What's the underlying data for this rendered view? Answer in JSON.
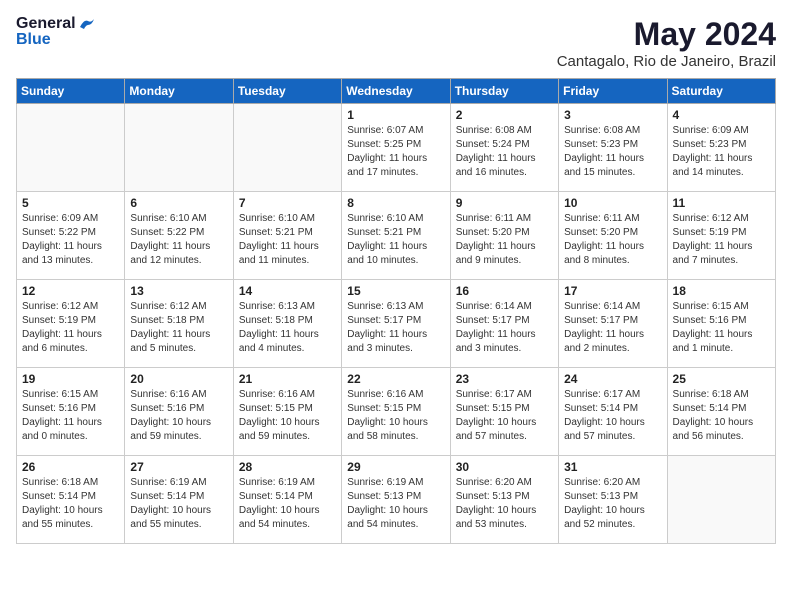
{
  "header": {
    "logo_general": "General",
    "logo_blue": "Blue",
    "month_title": "May 2024",
    "location": "Cantagalo, Rio de Janeiro, Brazil"
  },
  "weekdays": [
    "Sunday",
    "Monday",
    "Tuesday",
    "Wednesday",
    "Thursday",
    "Friday",
    "Saturday"
  ],
  "weeks": [
    [
      {
        "day": "",
        "info": ""
      },
      {
        "day": "",
        "info": ""
      },
      {
        "day": "",
        "info": ""
      },
      {
        "day": "1",
        "info": "Sunrise: 6:07 AM\nSunset: 5:25 PM\nDaylight: 11 hours\nand 17 minutes."
      },
      {
        "day": "2",
        "info": "Sunrise: 6:08 AM\nSunset: 5:24 PM\nDaylight: 11 hours\nand 16 minutes."
      },
      {
        "day": "3",
        "info": "Sunrise: 6:08 AM\nSunset: 5:23 PM\nDaylight: 11 hours\nand 15 minutes."
      },
      {
        "day": "4",
        "info": "Sunrise: 6:09 AM\nSunset: 5:23 PM\nDaylight: 11 hours\nand 14 minutes."
      }
    ],
    [
      {
        "day": "5",
        "info": "Sunrise: 6:09 AM\nSunset: 5:22 PM\nDaylight: 11 hours\nand 13 minutes."
      },
      {
        "day": "6",
        "info": "Sunrise: 6:10 AM\nSunset: 5:22 PM\nDaylight: 11 hours\nand 12 minutes."
      },
      {
        "day": "7",
        "info": "Sunrise: 6:10 AM\nSunset: 5:21 PM\nDaylight: 11 hours\nand 11 minutes."
      },
      {
        "day": "8",
        "info": "Sunrise: 6:10 AM\nSunset: 5:21 PM\nDaylight: 11 hours\nand 10 minutes."
      },
      {
        "day": "9",
        "info": "Sunrise: 6:11 AM\nSunset: 5:20 PM\nDaylight: 11 hours\nand 9 minutes."
      },
      {
        "day": "10",
        "info": "Sunrise: 6:11 AM\nSunset: 5:20 PM\nDaylight: 11 hours\nand 8 minutes."
      },
      {
        "day": "11",
        "info": "Sunrise: 6:12 AM\nSunset: 5:19 PM\nDaylight: 11 hours\nand 7 minutes."
      }
    ],
    [
      {
        "day": "12",
        "info": "Sunrise: 6:12 AM\nSunset: 5:19 PM\nDaylight: 11 hours\nand 6 minutes."
      },
      {
        "day": "13",
        "info": "Sunrise: 6:12 AM\nSunset: 5:18 PM\nDaylight: 11 hours\nand 5 minutes."
      },
      {
        "day": "14",
        "info": "Sunrise: 6:13 AM\nSunset: 5:18 PM\nDaylight: 11 hours\nand 4 minutes."
      },
      {
        "day": "15",
        "info": "Sunrise: 6:13 AM\nSunset: 5:17 PM\nDaylight: 11 hours\nand 3 minutes."
      },
      {
        "day": "16",
        "info": "Sunrise: 6:14 AM\nSunset: 5:17 PM\nDaylight: 11 hours\nand 3 minutes."
      },
      {
        "day": "17",
        "info": "Sunrise: 6:14 AM\nSunset: 5:17 PM\nDaylight: 11 hours\nand 2 minutes."
      },
      {
        "day": "18",
        "info": "Sunrise: 6:15 AM\nSunset: 5:16 PM\nDaylight: 11 hours\nand 1 minute."
      }
    ],
    [
      {
        "day": "19",
        "info": "Sunrise: 6:15 AM\nSunset: 5:16 PM\nDaylight: 11 hours\nand 0 minutes."
      },
      {
        "day": "20",
        "info": "Sunrise: 6:16 AM\nSunset: 5:16 PM\nDaylight: 10 hours\nand 59 minutes."
      },
      {
        "day": "21",
        "info": "Sunrise: 6:16 AM\nSunset: 5:15 PM\nDaylight: 10 hours\nand 59 minutes."
      },
      {
        "day": "22",
        "info": "Sunrise: 6:16 AM\nSunset: 5:15 PM\nDaylight: 10 hours\nand 58 minutes."
      },
      {
        "day": "23",
        "info": "Sunrise: 6:17 AM\nSunset: 5:15 PM\nDaylight: 10 hours\nand 57 minutes."
      },
      {
        "day": "24",
        "info": "Sunrise: 6:17 AM\nSunset: 5:14 PM\nDaylight: 10 hours\nand 57 minutes."
      },
      {
        "day": "25",
        "info": "Sunrise: 6:18 AM\nSunset: 5:14 PM\nDaylight: 10 hours\nand 56 minutes."
      }
    ],
    [
      {
        "day": "26",
        "info": "Sunrise: 6:18 AM\nSunset: 5:14 PM\nDaylight: 10 hours\nand 55 minutes."
      },
      {
        "day": "27",
        "info": "Sunrise: 6:19 AM\nSunset: 5:14 PM\nDaylight: 10 hours\nand 55 minutes."
      },
      {
        "day": "28",
        "info": "Sunrise: 6:19 AM\nSunset: 5:14 PM\nDaylight: 10 hours\nand 54 minutes."
      },
      {
        "day": "29",
        "info": "Sunrise: 6:19 AM\nSunset: 5:13 PM\nDaylight: 10 hours\nand 54 minutes."
      },
      {
        "day": "30",
        "info": "Sunrise: 6:20 AM\nSunset: 5:13 PM\nDaylight: 10 hours\nand 53 minutes."
      },
      {
        "day": "31",
        "info": "Sunrise: 6:20 AM\nSunset: 5:13 PM\nDaylight: 10 hours\nand 52 minutes."
      },
      {
        "day": "",
        "info": ""
      }
    ]
  ]
}
